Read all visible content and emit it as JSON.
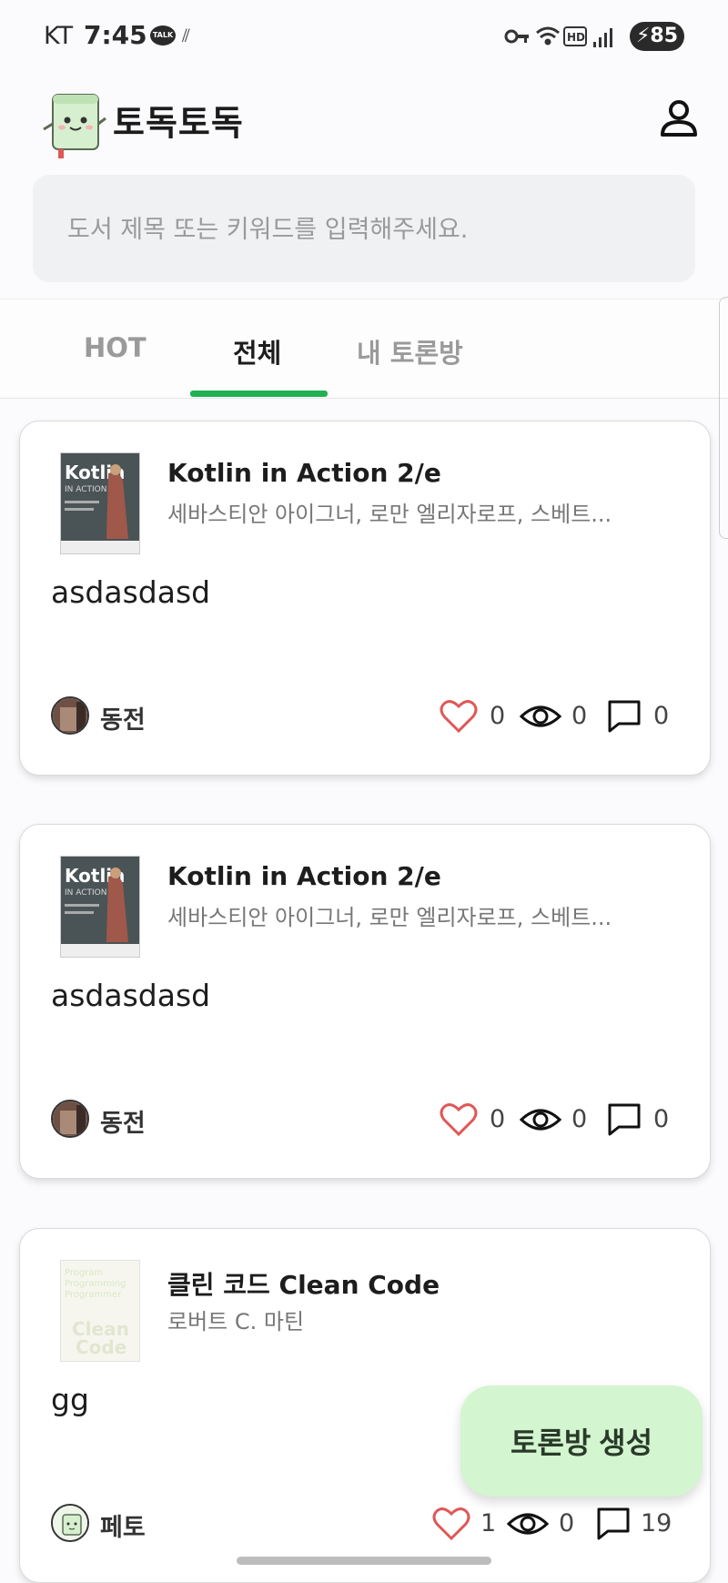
{
  "status": {
    "carrier": "KT",
    "time": "7:45",
    "talk": "TALK",
    "battery": "85"
  },
  "app": {
    "title": "토독토독"
  },
  "search": {
    "placeholder": "도서 제목 또는 키워드를 입력해주세요."
  },
  "tabs": [
    {
      "label": "HOT"
    },
    {
      "label": "전체"
    },
    {
      "label": "내 토론방"
    }
  ],
  "cards": [
    {
      "book_title": "Kotlin in Action 2/e",
      "book_author": "세바스티안 아이그너, 로만 엘리자로프, 스베트...",
      "text": "asdasdasd",
      "author": "동전",
      "likes": "0",
      "views": "0",
      "comments": "0"
    },
    {
      "book_title": "Kotlin in Action 2/e",
      "book_author": "세바스티안 아이그너, 로만 엘리자로프, 스베트...",
      "text": "asdasdasd",
      "author": "동전",
      "likes": "0",
      "views": "0",
      "comments": "0"
    },
    {
      "book_title": "클린 코드 Clean Code",
      "book_author": "로버트 C. 마틴",
      "text": "gg",
      "author": "페토",
      "likes": "1",
      "views": "0",
      "comments": "19"
    }
  ],
  "fab": {
    "label": "토론방 생성"
  },
  "colors": {
    "accent": "#22b152",
    "fab_bg": "#d3f5cf",
    "heart": "#e05757"
  }
}
